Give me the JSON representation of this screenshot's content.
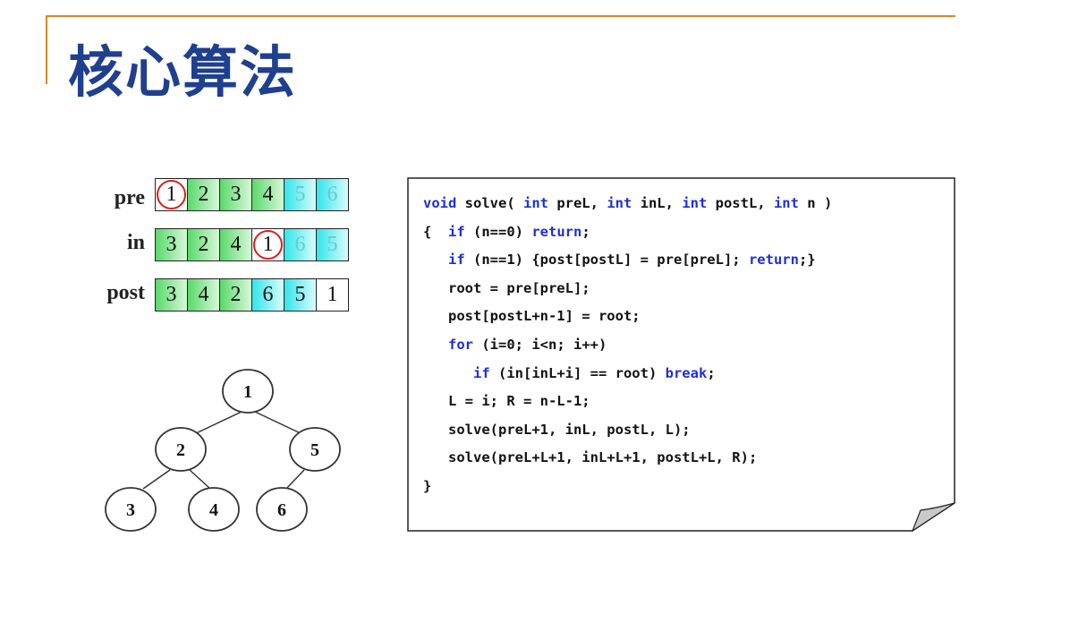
{
  "slide": {
    "title": "核心算法"
  },
  "arrays": [
    {
      "label": "pre",
      "cells": [
        {
          "value": "1",
          "style": "white",
          "circled": true
        },
        {
          "value": "2",
          "style": "green"
        },
        {
          "value": "3",
          "style": "green"
        },
        {
          "value": "4",
          "style": "green"
        },
        {
          "value": "5",
          "style": "cyan"
        },
        {
          "value": "6",
          "style": "cyan"
        }
      ]
    },
    {
      "label": "in",
      "cells": [
        {
          "value": "3",
          "style": "green"
        },
        {
          "value": "2",
          "style": "green"
        },
        {
          "value": "4",
          "style": "green"
        },
        {
          "value": "1",
          "style": "white",
          "circled": true
        },
        {
          "value": "6",
          "style": "cyan"
        },
        {
          "value": "5",
          "style": "cyan"
        }
      ]
    },
    {
      "label": "post",
      "cells": [
        {
          "value": "3",
          "style": "green"
        },
        {
          "value": "4",
          "style": "green"
        },
        {
          "value": "2",
          "style": "green"
        },
        {
          "value": "6",
          "style": "cyan-dark"
        },
        {
          "value": "5",
          "style": "cyan-dark"
        },
        {
          "value": "1",
          "style": "white"
        }
      ]
    }
  ],
  "tree": {
    "nodes": [
      "1",
      "2",
      "5",
      "3",
      "4",
      "6"
    ],
    "edges": [
      [
        "1",
        "2"
      ],
      [
        "1",
        "5"
      ],
      [
        "2",
        "3"
      ],
      [
        "2",
        "4"
      ],
      [
        "5",
        "6"
      ]
    ]
  },
  "code": {
    "lines": [
      [
        {
          "t": "void",
          "k": true
        },
        {
          "t": " solve( "
        },
        {
          "t": "int",
          "k": true
        },
        {
          "t": " preL, "
        },
        {
          "t": "int",
          "k": true
        },
        {
          "t": " inL, "
        },
        {
          "t": "int",
          "k": true
        },
        {
          "t": " postL, "
        },
        {
          "t": "int",
          "k": true
        },
        {
          "t": " n )"
        }
      ],
      [
        {
          "t": "{  "
        },
        {
          "t": "if",
          "k": true
        },
        {
          "t": " (n==0) "
        },
        {
          "t": "return",
          "k": true
        },
        {
          "t": ";"
        }
      ],
      [
        {
          "t": "   "
        },
        {
          "t": "if",
          "k": true
        },
        {
          "t": " (n==1) {post[postL] = pre[preL]; "
        },
        {
          "t": "return",
          "k": true
        },
        {
          "t": ";}"
        }
      ],
      [
        {
          "t": "   root = pre[preL];"
        }
      ],
      [
        {
          "t": "   post[postL+n-1] = root;"
        }
      ],
      [
        {
          "t": "   "
        },
        {
          "t": "for",
          "k": true
        },
        {
          "t": " (i=0; i<n; i++)"
        }
      ],
      [
        {
          "t": "      "
        },
        {
          "t": "if",
          "k": true
        },
        {
          "t": " (in[inL+i] == root) "
        },
        {
          "t": "break",
          "k": true
        },
        {
          "t": ";"
        }
      ],
      [
        {
          "t": "   L = i; R = n-L-1;"
        }
      ],
      [
        {
          "t": "   solve(preL+1, inL, postL, L);"
        }
      ],
      [
        {
          "t": "   solve(preL+L+1, inL+L+1, postL+L, R);"
        }
      ],
      [
        {
          "t": "}"
        }
      ]
    ]
  }
}
